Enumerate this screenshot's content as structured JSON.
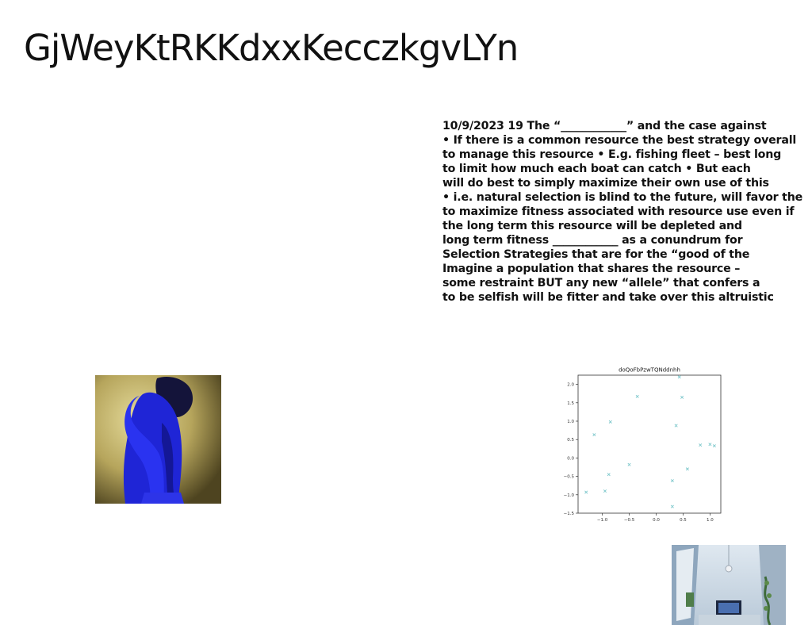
{
  "page": {
    "title": "GjWeyKtRKKdxxKecczkgvLYn"
  },
  "text_block": {
    "lines": [
      "10/9/2023 19 The “____________” and the case against",
      "• If there is a common resource the best strategy overall",
      "to manage this resource • E.g. fishing fleet – best long",
      "to limit how much each boat can catch • But each",
      "will do best to simply maximize their own use of this",
      "• i.e. natural selection is blind to the future, will favor the",
      "to maximize fitness associated with resource use even if",
      "the long term this resource will be depleted and",
      "long term fitness ____________ as a conundrum for",
      "Selection Strategies that are for the “good of the",
      "Imagine a population that shares the resource –",
      "some restraint BUT any new “allele” that confers a",
      "to be selfish will be fitter and take over this altruistic"
    ]
  },
  "images": {
    "person_photo": "person in blue against yellow background",
    "room_photo": "interior of a bright room with a TV and plants"
  },
  "chart_data": {
    "type": "scatter",
    "title": "doQoFbPzwTQNddnhh",
    "xlabel": "",
    "ylabel": "",
    "xlim": [
      -1.45,
      1.2
    ],
    "ylim": [
      -1.5,
      2.25
    ],
    "xticks": [
      -1.0,
      -0.5,
      0.0,
      0.5,
      1.0
    ],
    "xtick_labels": [
      "−1.0",
      "−0.5",
      "0.0",
      "0.5",
      "1.0"
    ],
    "yticks": [
      -1.5,
      -1.0,
      -0.5,
      0.0,
      0.5,
      1.0,
      1.5,
      2.0
    ],
    "ytick_labels": [
      "−1.5",
      "−1.0",
      "−0.5",
      "0.0",
      "0.5",
      "1.0",
      "1.5",
      "2.0"
    ],
    "grid": false,
    "marker": "x",
    "color": "#7ec8cc",
    "points": [
      {
        "x": 0.43,
        "y": 2.2
      },
      {
        "x": -0.35,
        "y": 1.67
      },
      {
        "x": 0.48,
        "y": 1.65
      },
      {
        "x": -0.85,
        "y": 0.98
      },
      {
        "x": 0.37,
        "y": 0.88
      },
      {
        "x": -1.15,
        "y": 0.63
      },
      {
        "x": 0.82,
        "y": 0.35
      },
      {
        "x": 1.0,
        "y": 0.37
      },
      {
        "x": 1.08,
        "y": 0.33
      },
      {
        "x": -0.5,
        "y": -0.18
      },
      {
        "x": 0.58,
        "y": -0.3
      },
      {
        "x": -0.88,
        "y": -0.45
      },
      {
        "x": 0.3,
        "y": -0.62
      },
      {
        "x": -0.95,
        "y": -0.9
      },
      {
        "x": -1.3,
        "y": -0.93
      },
      {
        "x": 0.3,
        "y": -1.32
      }
    ]
  }
}
